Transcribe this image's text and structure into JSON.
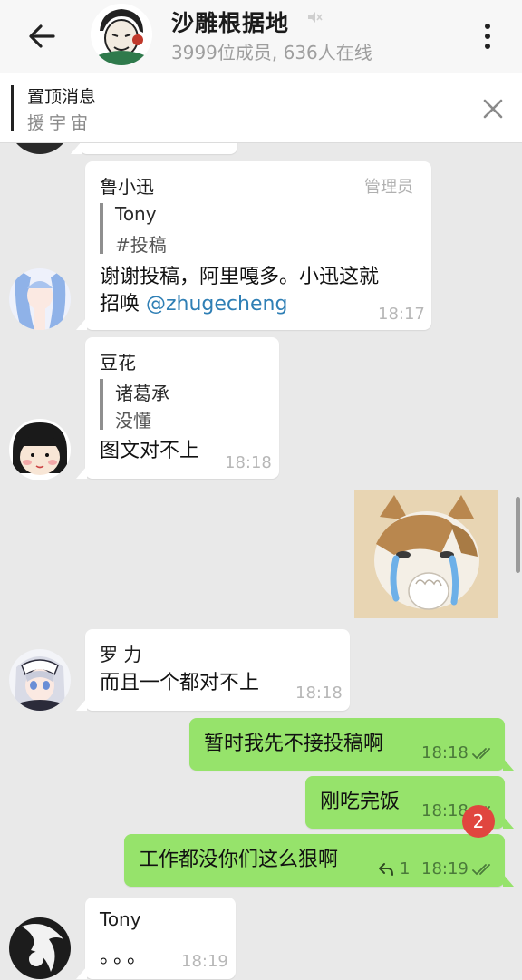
{
  "header": {
    "title": "沙雕根据地",
    "subtitle": "3999位成员, 636人在线",
    "back_icon": "arrow-left-icon",
    "more_icon": "more-vertical-icon",
    "mute_icon": "muted-speaker-icon"
  },
  "pinned": {
    "title": "置顶消息",
    "text": "援宇宙",
    "close_icon": "close-icon"
  },
  "messages": [
    {
      "sender": "鲁小迅",
      "role": "管理员",
      "quote_name": "Tony",
      "quote_text": "#投稿",
      "text_line1": "谢谢投稿，阿里嘎多。小迅这就",
      "text_line2_prefix": "招唤 ",
      "mention": "@zhugecheng",
      "time": "18:17"
    },
    {
      "sender": "豆花",
      "quote_name": "诸葛承",
      "quote_text": "没懂",
      "text": "图文对不上",
      "time": "18:18"
    },
    {
      "type": "sticker",
      "description": "crying-cat-sticker"
    },
    {
      "sender": "罗 力",
      "text": "而且一个都对不上",
      "time": "18:18"
    },
    {
      "outgoing": true,
      "text": "暂时我先不接投稿啊",
      "time": "18:18"
    },
    {
      "outgoing": true,
      "text": "刚吃完饭",
      "time": "18:18"
    },
    {
      "outgoing": true,
      "text": "工作都没你们这么狠啊",
      "reply_count": "1",
      "time": "18:19"
    },
    {
      "sender": "Tony",
      "text": "。。。",
      "time": "18:19"
    }
  ],
  "unread_badge": "2",
  "colors": {
    "outgoing_bubble": "#96e36b",
    "incoming_bubble": "#ffffff",
    "chat_background": "#e9e9e9",
    "mention": "#2f7fb5",
    "badge": "#e0463f"
  }
}
